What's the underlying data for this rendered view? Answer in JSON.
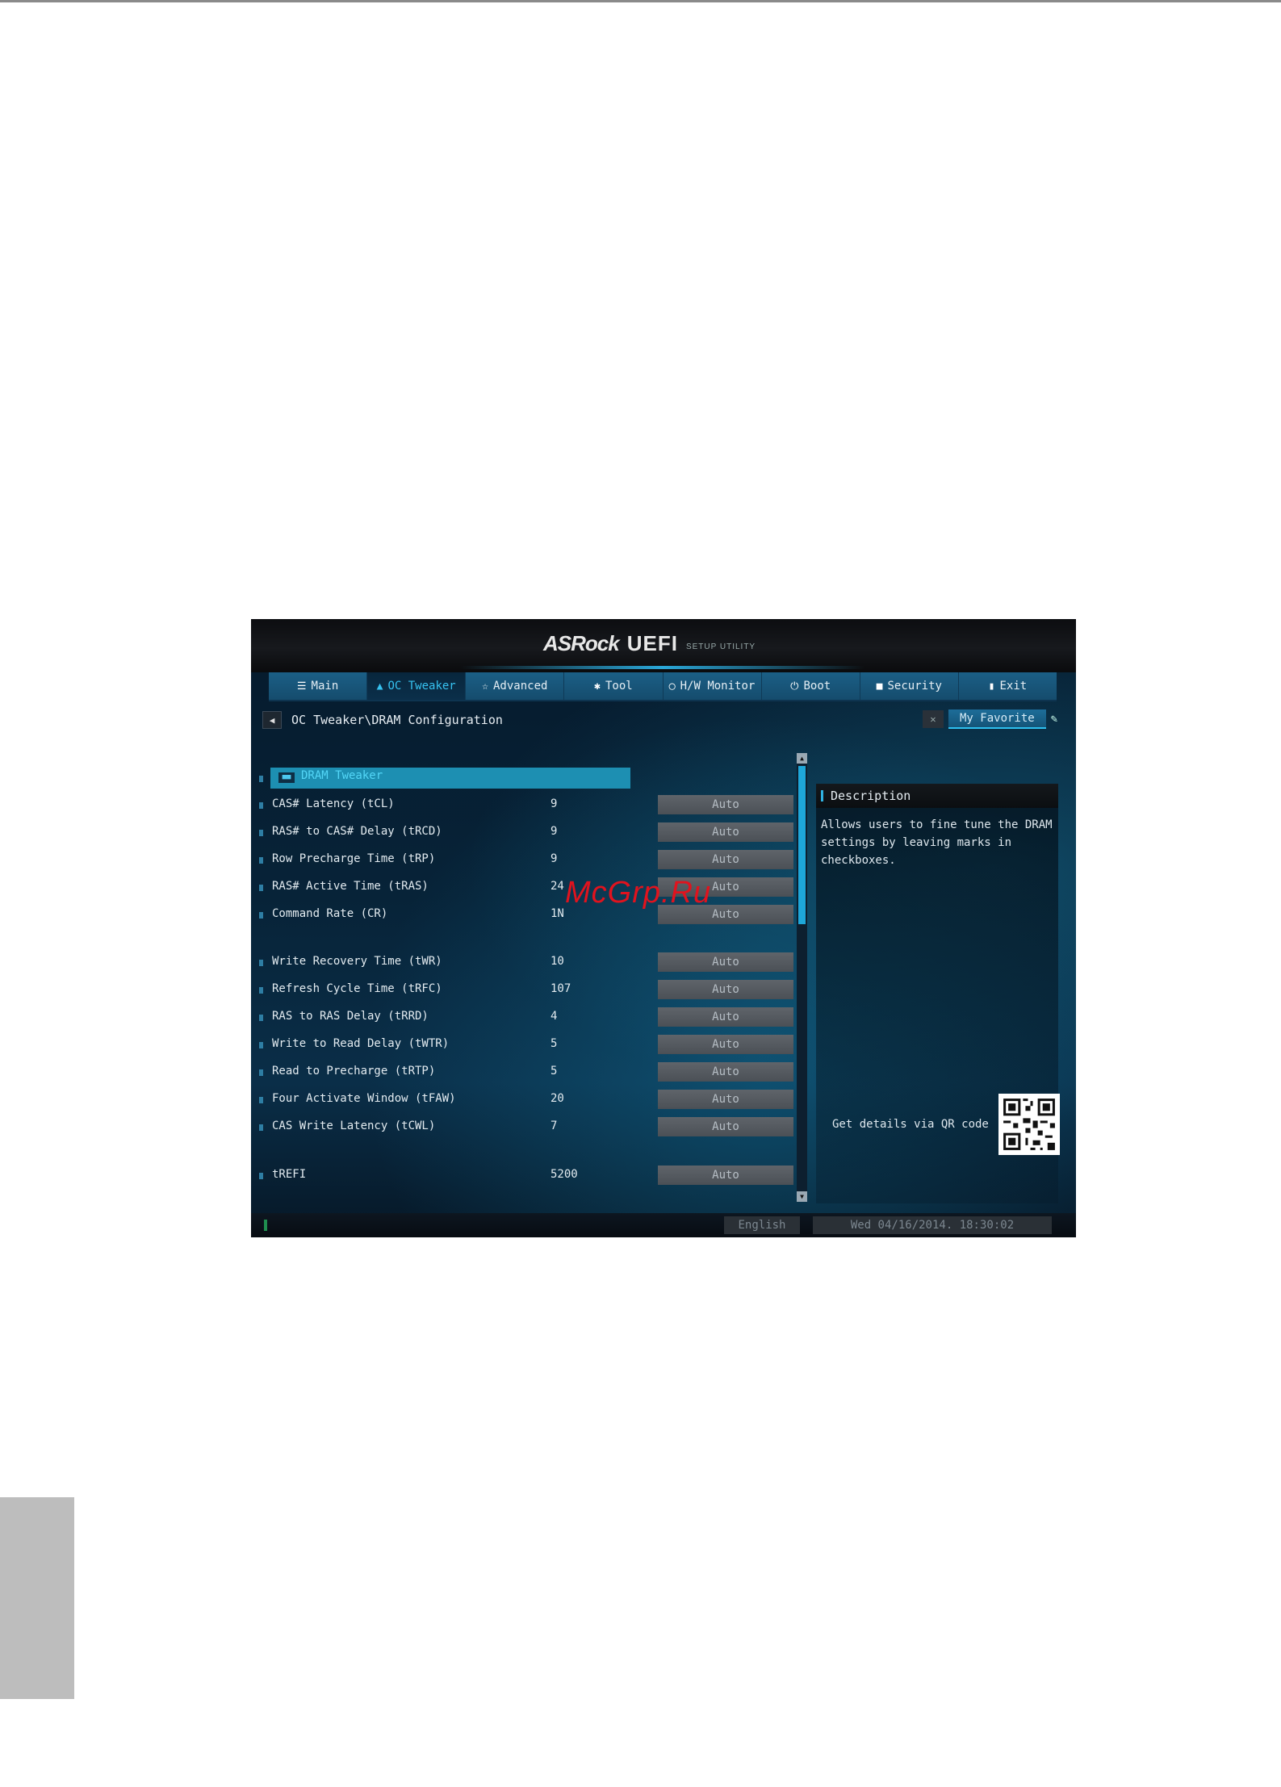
{
  "header": {
    "brand": "ASRock",
    "product": "UEFI",
    "subtitle": "SETUP UTILITY"
  },
  "tabs": [
    {
      "label": "Main",
      "icon": "list-icon",
      "active": false
    },
    {
      "label": "OC Tweaker",
      "icon": "flame-icon",
      "active": true
    },
    {
      "label": "Advanced",
      "icon": "star-icon",
      "active": false
    },
    {
      "label": "Tool",
      "icon": "tool-icon",
      "active": false
    },
    {
      "label": "H/W Monitor",
      "icon": "monitor-icon",
      "active": false
    },
    {
      "label": "Boot",
      "icon": "power-icon",
      "active": false
    },
    {
      "label": "Security",
      "icon": "shield-icon",
      "active": false
    },
    {
      "label": "Exit",
      "icon": "exit-icon",
      "active": false
    }
  ],
  "breadcrumb": "OC Tweaker\\DRAM Configuration",
  "favorite": {
    "label": "My Favorite"
  },
  "section": {
    "badge": "■■",
    "label": "DRAM Tweaker"
  },
  "settings": [
    {
      "label": "CAS# Latency (tCL)",
      "value": "9",
      "option": "Auto"
    },
    {
      "label": "RAS# to CAS# Delay (tRCD)",
      "value": "9",
      "option": "Auto"
    },
    {
      "label": "Row Precharge Time (tRP)",
      "value": "9",
      "option": "Auto"
    },
    {
      "label": "RAS# Active Time (tRAS)",
      "value": "24",
      "option": "Auto"
    },
    {
      "label": "Command Rate (CR)",
      "value": "1N",
      "option": "Auto"
    },
    {
      "label": "Write Recovery Time (tWR)",
      "value": "10",
      "option": "Auto"
    },
    {
      "label": "Refresh Cycle Time (tRFC)",
      "value": "107",
      "option": "Auto"
    },
    {
      "label": "RAS to RAS Delay (tRRD)",
      "value": "4",
      "option": "Auto"
    },
    {
      "label": "Write to Read Delay (tWTR)",
      "value": "5",
      "option": "Auto"
    },
    {
      "label": "Read to Precharge (tRTP)",
      "value": "5",
      "option": "Auto"
    },
    {
      "label": "Four Activate Window (tFAW)",
      "value": "20",
      "option": "Auto"
    },
    {
      "label": "CAS Write Latency (tCWL)",
      "value": "7",
      "option": "Auto"
    },
    {
      "label": "tREFI",
      "value": "5200",
      "option": "Auto"
    }
  ],
  "description": {
    "title": "Description",
    "body": "Allows users to fine tune the DRAM settings by leaving marks in checkboxes.",
    "qr_label": "Get details via QR code"
  },
  "status": {
    "language": "English",
    "datetime": "Wed 04/16/2014. 18:30:02"
  },
  "watermark": "McGrp.Ru",
  "colors": {
    "accent": "#1ea7d9",
    "tab_bar": "#1b5f86",
    "watermark": "#e0131e"
  }
}
